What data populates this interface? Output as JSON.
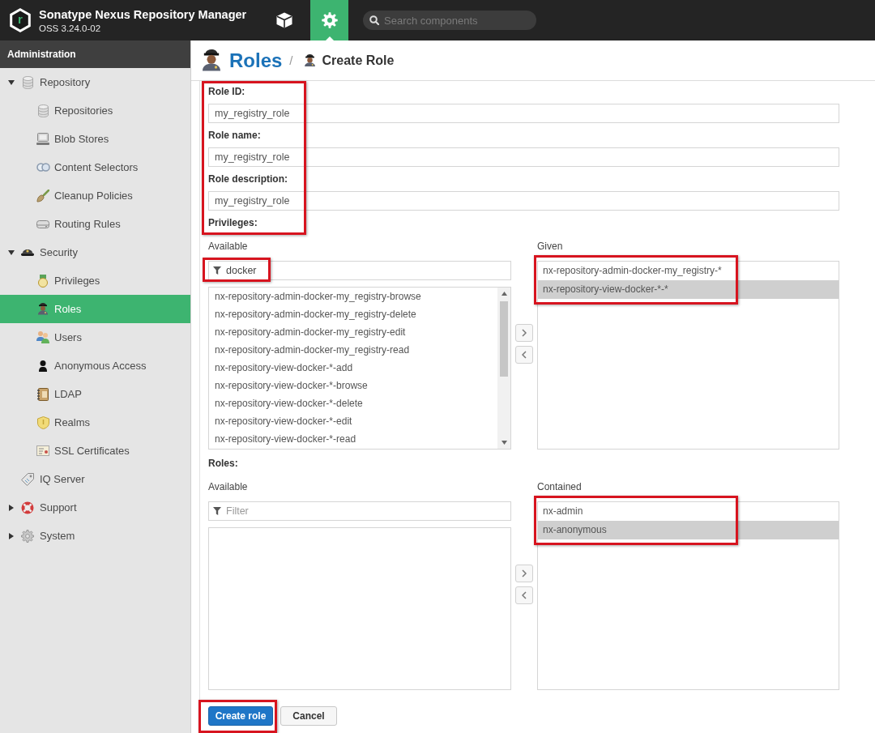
{
  "header": {
    "logo": "r",
    "title": "Sonatype Nexus Repository Manager",
    "version": "OSS 3.24.0-02",
    "nav": [
      {
        "kind": "browse",
        "selected": false
      },
      {
        "kind": "admin",
        "selected": true
      }
    ],
    "search": {
      "placeholder": "Search components"
    }
  },
  "sidebar": {
    "title": "Administration",
    "items": [
      {
        "kind": "repository",
        "label": "Repository",
        "expanded": true,
        "selected": false,
        "children": [
          {
            "kind": "repositories",
            "label": "Repositories",
            "selected": false
          },
          {
            "kind": "blobstores",
            "label": "Blob Stores",
            "selected": false
          },
          {
            "kind": "selectors",
            "label": "Content Selectors",
            "selected": false
          },
          {
            "kind": "cleanup",
            "label": "Cleanup Policies",
            "selected": false
          },
          {
            "kind": "routing",
            "label": "Routing Rules",
            "selected": false
          }
        ]
      },
      {
        "kind": "security",
        "label": "Security",
        "expanded": true,
        "selected": false,
        "children": [
          {
            "kind": "privileges",
            "label": "Privileges",
            "selected": false
          },
          {
            "kind": "roles",
            "label": "Roles",
            "selected": true
          },
          {
            "kind": "users",
            "label": "Users",
            "selected": false
          },
          {
            "kind": "anonymous",
            "label": "Anonymous Access",
            "selected": false
          },
          {
            "kind": "ldap",
            "label": "LDAP",
            "selected": false
          },
          {
            "kind": "realms",
            "label": "Realms",
            "selected": false
          },
          {
            "kind": "ssl",
            "label": "SSL Certificates",
            "selected": false
          }
        ]
      },
      {
        "kind": "iq",
        "label": "IQ Server",
        "selected": false
      },
      {
        "kind": "support",
        "label": "Support",
        "expanded": false,
        "selected": false
      },
      {
        "kind": "system",
        "label": "System",
        "expanded": false,
        "selected": false
      }
    ]
  },
  "page": {
    "title": "Roles",
    "separator": "/",
    "subtitle": "Create Role"
  },
  "form": {
    "highlighted": true,
    "fields": [
      {
        "label": "Role ID:",
        "value": "my_registry_role"
      },
      {
        "label": "Role name:",
        "value": "my_registry_role"
      },
      {
        "label": "Role description:",
        "value": "my_registry_role"
      }
    ]
  },
  "privileges": {
    "label": "Privileges:",
    "available": {
      "label": "Available",
      "filter": {
        "value": "docker",
        "highlighted": true
      },
      "scrollable": true,
      "items": [
        {
          "label": "nx-repository-admin-docker-my_registry-browse",
          "selected": false
        },
        {
          "label": "nx-repository-admin-docker-my_registry-delete",
          "selected": false
        },
        {
          "label": "nx-repository-admin-docker-my_registry-edit",
          "selected": false
        },
        {
          "label": "nx-repository-admin-docker-my_registry-read",
          "selected": false
        },
        {
          "label": "nx-repository-view-docker-*-add",
          "selected": false
        },
        {
          "label": "nx-repository-view-docker-*-browse",
          "selected": false
        },
        {
          "label": "nx-repository-view-docker-*-delete",
          "selected": false
        },
        {
          "label": "nx-repository-view-docker-*-edit",
          "selected": false
        },
        {
          "label": "nx-repository-view-docker-*-read",
          "selected": false
        }
      ]
    },
    "given": {
      "label": "Given",
      "highlighted": true,
      "items": [
        {
          "label": "nx-repository-admin-docker-my_registry-*",
          "selected": false
        },
        {
          "label": "nx-repository-view-docker-*-*",
          "selected": true
        }
      ]
    }
  },
  "roles": {
    "label": "Roles:",
    "available": {
      "label": "Available",
      "filter": {
        "placeholder": "Filter"
      }
    },
    "contained": {
      "label": "Contained",
      "highlighted": true,
      "items": [
        {
          "label": "nx-admin",
          "selected": false
        },
        {
          "label": "nx-anonymous",
          "selected": true
        }
      ]
    }
  },
  "buttons": [
    {
      "kind": "primary",
      "label": "Create role",
      "highlighted": true
    },
    {
      "kind": "secondary",
      "label": "Cancel"
    }
  ]
}
